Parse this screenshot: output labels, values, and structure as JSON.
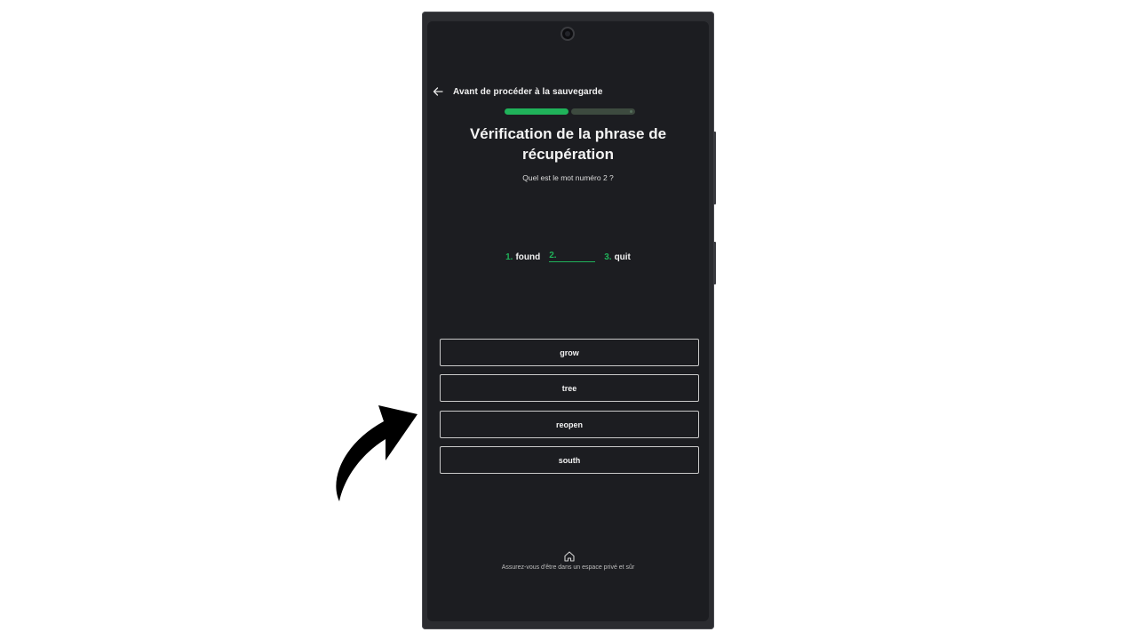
{
  "header": {
    "title": "Avant de procéder à la sauvegarde"
  },
  "progress": {
    "steps_total": 2,
    "steps_done": 1
  },
  "main": {
    "title_line1": "Vérification de la phrase de",
    "title_line2": "récupération",
    "question": "Quel est le mot numéro 2 ?"
  },
  "words": [
    {
      "num": "1.",
      "word": "found"
    },
    {
      "num": "2.",
      "word": ""
    },
    {
      "num": "3.",
      "word": "quit"
    }
  ],
  "options": [
    "grow",
    "tree",
    "reopen",
    "south"
  ],
  "footer": {
    "icon": "home-icon",
    "text": "Assurez-vous d'être dans un espace privé et sûr"
  },
  "colors": {
    "accent": "#20b25a",
    "background": "#1c1d21",
    "text": "#f2f2f2"
  }
}
